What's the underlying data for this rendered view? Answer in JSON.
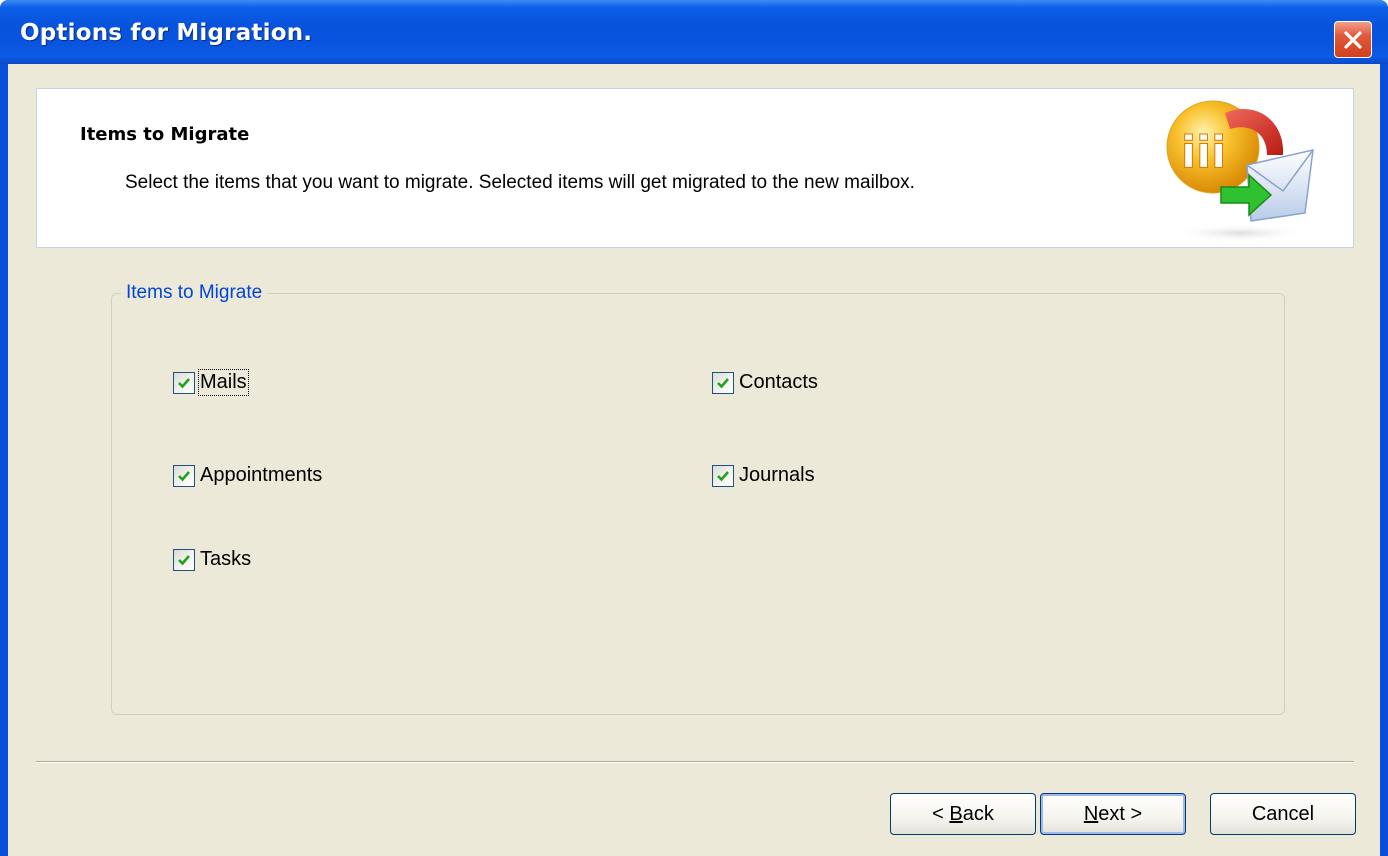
{
  "window": {
    "title": "Options for Migration."
  },
  "header": {
    "title": "Items to Migrate",
    "description": "Select the items that you want to migrate. Selected items will get migrated to the new mailbox."
  },
  "group": {
    "legend": "Items to Migrate",
    "items": [
      {
        "label": "Mails",
        "checked": true
      },
      {
        "label": "Contacts",
        "checked": true
      },
      {
        "label": "Appointments",
        "checked": true
      },
      {
        "label": "Journals",
        "checked": true
      },
      {
        "label": "Tasks",
        "checked": true
      }
    ]
  },
  "buttons": {
    "back_prefix": "< ",
    "back_mnemonic": "B",
    "back_rest": "ack",
    "next_mnemonic": "N",
    "next_rest": "ext >",
    "cancel": "Cancel"
  },
  "colors": {
    "titlebar": "#0a55df",
    "dialog_bg": "#ece9d8",
    "legend_text": "#0046d5",
    "check_mark": "#21a121",
    "close_button": "#e2573b"
  },
  "icons": {
    "close": "close-x-icon",
    "check": "checkmark-icon",
    "logo": "migration-logo-icon"
  }
}
